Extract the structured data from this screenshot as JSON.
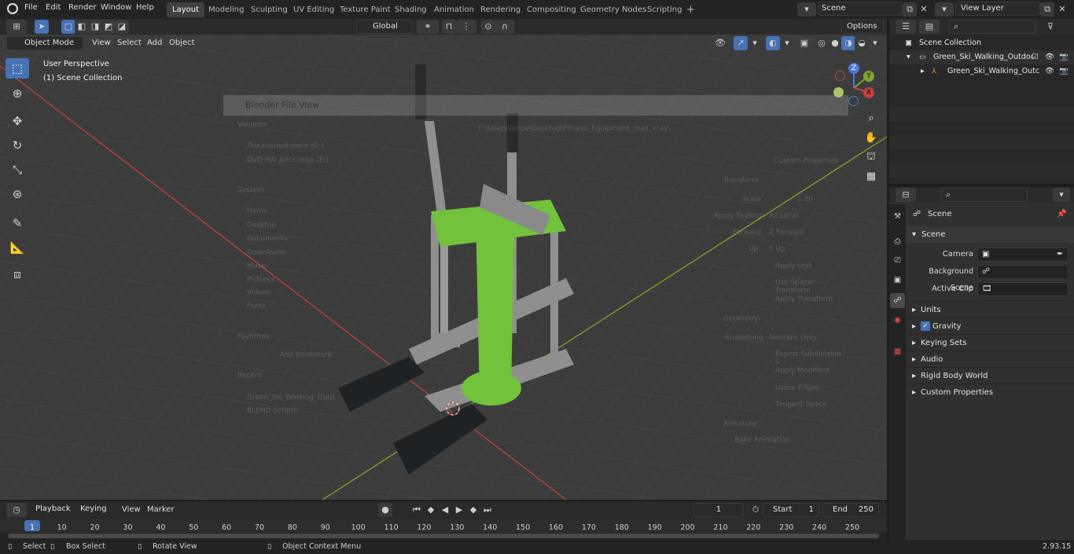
{
  "topbar": {
    "menus": [
      "File",
      "Edit",
      "Render",
      "Window",
      "Help"
    ],
    "workspaces": [
      "Layout",
      "Modeling",
      "Sculpting",
      "UV Editing",
      "Texture Paint",
      "Shading",
      "Animation",
      "Rendering",
      "Compositing",
      "Geometry Nodes",
      "Scripting"
    ],
    "add_tab": "+",
    "scene_name": "Scene",
    "view_layer": "View Layer"
  },
  "viewport_header": {
    "mode": "Object Mode",
    "menus": [
      "View",
      "Select",
      "Add",
      "Object"
    ],
    "transform_orientation": "Global",
    "options": "Options"
  },
  "viewport": {
    "perspective": "User Perspective",
    "collection": "(1) Scene Collection",
    "gizmo": {
      "z": "Z",
      "y": "Y",
      "x": "X"
    },
    "overlay_dialog": {
      "title": "Blender File View",
      "sections": [
        "Volumes",
        "System",
        "Favorites",
        "Recent"
      ],
      "volumes": [
        "Локальный диск (C:)",
        "DVD RW дисковод (E:)"
      ],
      "system": [
        "Home",
        "Desktop",
        "Documents",
        "Downloads",
        "Music",
        "Pictures",
        "Videos",
        "Fonts"
      ],
      "favorites_add": "Add Bookmark",
      "recent": [
        "Green_Ski_Walking_Outdoor_Fitness_Equipment_max_vray",
        "BLEND Scripts"
      ],
      "path": "C:\\Users\\lenov\\Desktop\\Fitness_Equipment_max_vray\\",
      "right": {
        "custom_properties": "Custom Properties",
        "transform": "Transform",
        "scale_label": "Scale",
        "scale": "1.00",
        "apply_scaling_label": "Apply Scalings",
        "apply_scaling": "All Local",
        "forward_label": "Forward",
        "forward": "Z Forward",
        "up_label": "Up",
        "up": "Y Up",
        "apply_unit": "Apply Unit",
        "use_space_transform": "Use Space Transform",
        "apply_transform": "Apply Transform",
        "geometry": "Geometry",
        "smoothing_label": "Smoothing",
        "smoothing": "Normals Only",
        "export_subdivision": "Export Subdivision S...",
        "apply_modifiers": "Apply Modifiers",
        "loose_edges": "Loose Edges",
        "tangent_space": "Tangent Space",
        "armature": "Armature",
        "bake_animation": "Bake Animation"
      }
    }
  },
  "outliner": {
    "root": "Scene Collection",
    "items": [
      {
        "label": "Green_Ski_Walking_Outdoor_"
      },
      {
        "label": "Green_Ski_Walking_Outc"
      }
    ]
  },
  "properties": {
    "context": "Scene",
    "panel": "Scene",
    "fields": [
      {
        "label": "Camera"
      },
      {
        "label": "Background Scene"
      },
      {
        "label": "Active Clip"
      }
    ],
    "subpanels": [
      "Units",
      "Gravity",
      "Keying Sets",
      "Audio",
      "Rigid Body World",
      "Custom Properties"
    ]
  },
  "timeline": {
    "menus": [
      "Playback",
      "Keying",
      "View",
      "Marker"
    ],
    "current_frame": "1",
    "start_label": "Start",
    "start": "1",
    "end_label": "End",
    "end": "250",
    "ticks": [
      "1",
      "10",
      "20",
      "30",
      "40",
      "50",
      "60",
      "70",
      "80",
      "90",
      "100",
      "110",
      "120",
      "130",
      "140",
      "150",
      "160",
      "170",
      "180",
      "190",
      "200",
      "210",
      "220",
      "230",
      "240",
      "250"
    ]
  },
  "statusbar": {
    "select": "Select",
    "box_select": "Box Select",
    "rotate_view": "Rotate View",
    "context_menu": "Object Context Menu",
    "version": "2.93.15"
  },
  "colors": {
    "accent": "#4772b3",
    "object_green": "#72c23c",
    "frame_gray": "#8f8f8f",
    "x_axis": "#c0423f",
    "y_axis": "#7ea52d"
  }
}
